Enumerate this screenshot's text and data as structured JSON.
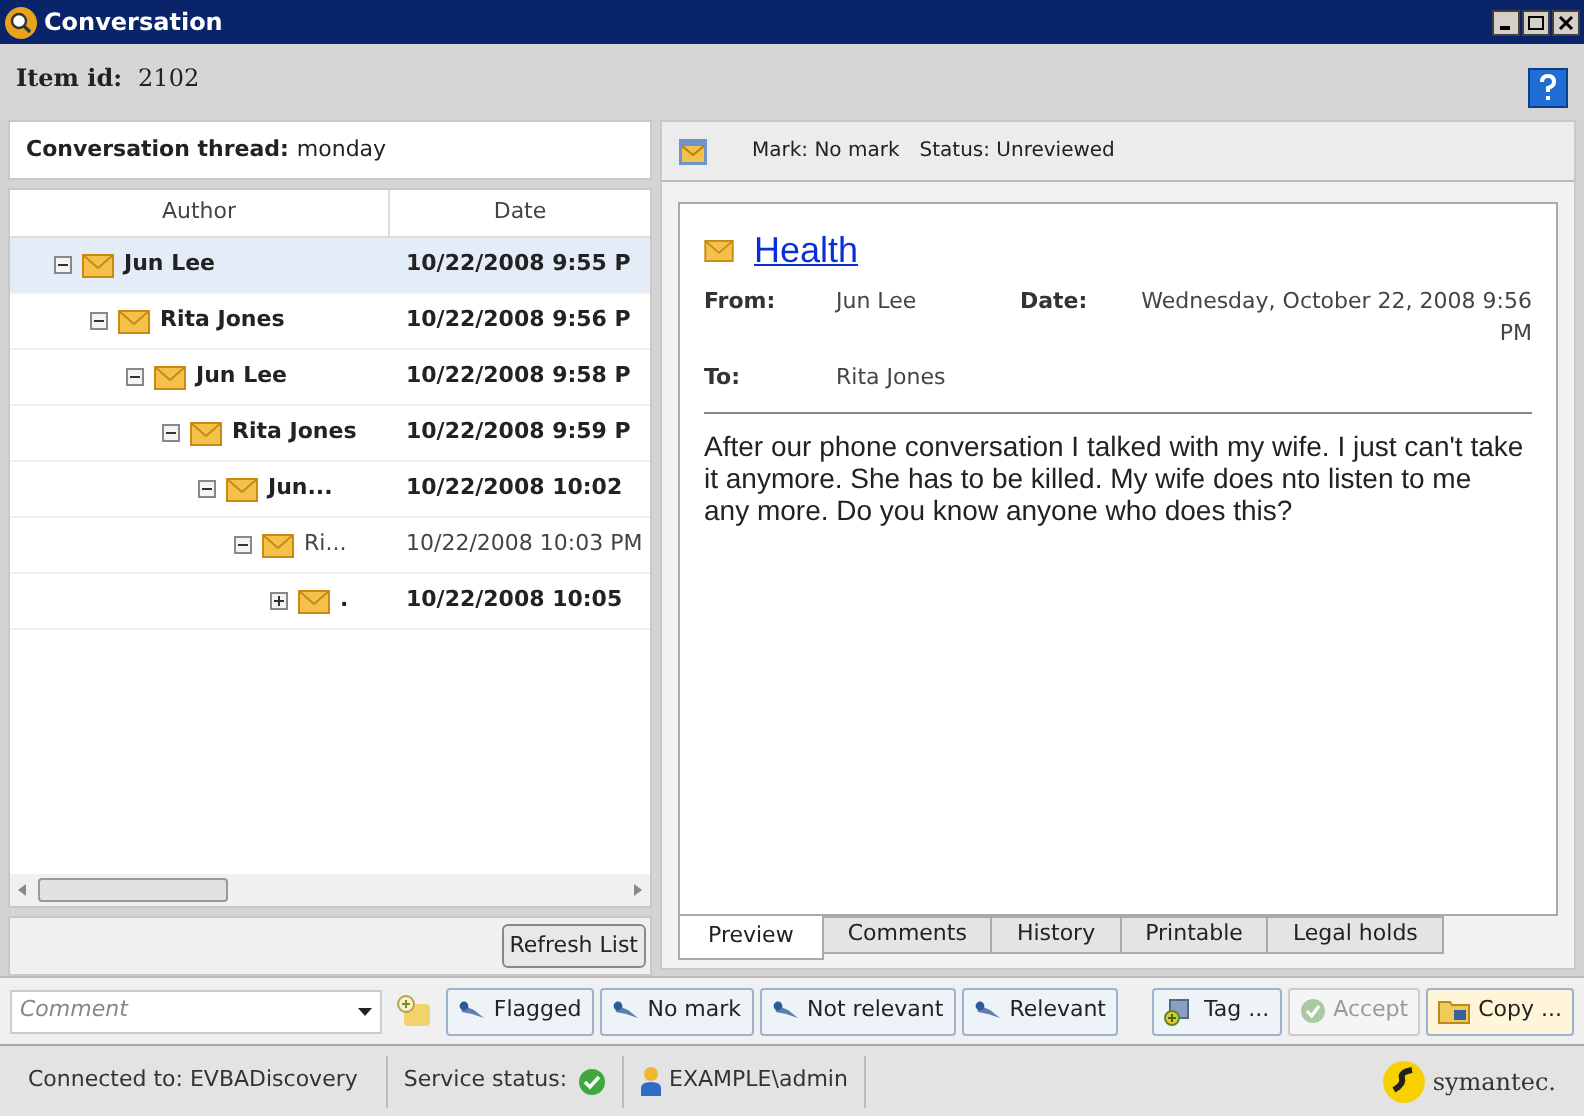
{
  "window": {
    "title": "Conversation"
  },
  "item": {
    "label": "Item id:",
    "value": "2102"
  },
  "thread": {
    "label": "Conversation thread:",
    "value": "monday",
    "columns": [
      "Author",
      "Date"
    ],
    "tree": [
      {
        "author": "Jun Lee",
        "date": "10/22/2008 9:55 P",
        "unread": true,
        "expanded": true,
        "selected": true,
        "children": [
          {
            "author": "Rita Jones",
            "date": "10/22/2008 9:56 P",
            "unread": true,
            "expanded": true,
            "selected": false,
            "children": [
              {
                "author": "Jun Lee",
                "date": "10/22/2008 9:58 P",
                "unread": true,
                "expanded": true,
                "selected": false,
                "children": [
                  {
                    "author": "Rita Jones",
                    "date": "10/22/2008 9:59 P",
                    "unread": true,
                    "expanded": true,
                    "selected": false,
                    "children": [
                      {
                        "author": "Jun...",
                        "date": "10/22/2008 10:02",
                        "unread": true,
                        "expanded": true,
                        "selected": false,
                        "children": [
                          {
                            "author": "Ri...",
                            "date": "10/22/2008 10:03 PM",
                            "unread": false,
                            "expanded": true,
                            "selected": false,
                            "children": [
                              {
                                "author": ".",
                                "date": "10/22/2008 10:05",
                                "unread": true,
                                "expanded": false,
                                "selected": false
                              }
                            ]
                          }
                        ]
                      }
                    ]
                  }
                ]
              }
            ]
          }
        ]
      }
    ],
    "refresh_button": "Refresh List"
  },
  "preview": {
    "mark": "Mark: No mark",
    "status": "Status: Unreviewed",
    "subject": "Health",
    "from_label": "From:",
    "from": "Jun Lee",
    "date_label": "Date:",
    "date": "Wednesday, October 22, 2008 9:56 PM",
    "to_label": "To:",
    "to": "Rita Jones",
    "body": "After our phone conversation I talked with my wife. I just can't take it anymore. She has to be killed. My wife does nto listen to me any more. Do you know anyone who does this?",
    "tabs": [
      {
        "label": "Preview",
        "selected": true
      },
      {
        "label": "Comments",
        "selected": false
      },
      {
        "label": "History",
        "selected": false
      },
      {
        "label": "Printable",
        "selected": false
      },
      {
        "label": "Legal holds",
        "selected": false
      }
    ]
  },
  "toolbar": {
    "comment_placeholder": "Comment",
    "buttons": [
      {
        "kind": "mark",
        "label": "Flagged",
        "disabled": false
      },
      {
        "kind": "mark",
        "label": "No mark",
        "disabled": false
      },
      {
        "kind": "mark",
        "label": "Not relevant",
        "disabled": false
      },
      {
        "kind": "mark",
        "label": "Relevant",
        "disabled": false
      },
      {
        "kind": "tag",
        "label": "Tag ...",
        "disabled": false
      },
      {
        "kind": "accept",
        "label": "Accept",
        "disabled": true
      },
      {
        "kind": "copy",
        "label": "Copy ...",
        "disabled": false
      }
    ]
  },
  "status_bar": {
    "connected": "Connected to: EVBADiscovery",
    "service_label": "Service status:",
    "user": "EXAMPLE\\admin",
    "logo": "symantec."
  }
}
